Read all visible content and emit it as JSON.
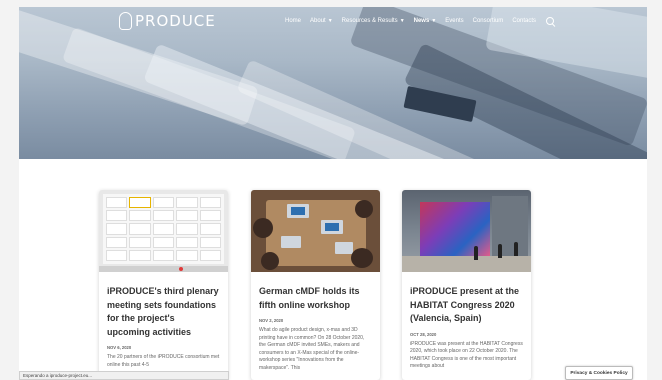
{
  "brand": {
    "logo_text": "PRODUCE"
  },
  "nav": {
    "items": [
      {
        "label": "Home",
        "dropdown": false,
        "active": false
      },
      {
        "label": "About",
        "dropdown": true,
        "active": false
      },
      {
        "label": "Resources & Results",
        "dropdown": true,
        "active": false
      },
      {
        "label": "News",
        "dropdown": true,
        "active": true
      },
      {
        "label": "Events",
        "dropdown": false,
        "active": false
      },
      {
        "label": "Consortium",
        "dropdown": false,
        "active": false
      },
      {
        "label": "Contacts",
        "dropdown": false,
        "active": false
      }
    ],
    "search_icon": "search-icon"
  },
  "cards": [
    {
      "title": "iPRODUCE's third plenary meeting sets foundations for the project's upcoming activities",
      "date": "NOV 6, 2020",
      "excerpt": "The 20 partners of the iPRODUCE consortium met online this past 4-5"
    },
    {
      "title": "German cMDF holds its fifth online workshop",
      "date": "NOV 2, 2020",
      "excerpt": "What do agile product design, x-mas and 3D printing have in common? On 28 October 2020, the German cMDF invited SMEs, makers and consumers to an X-Mas special of the online-workshop series \"Innovations from the makerspace\". This"
    },
    {
      "title": "iPRODUCE present at the HABITAT Congress 2020 (Valencia, Spain)",
      "date": "OCT 28, 2020",
      "excerpt": "iPRODUCE was present at the HABITAT Congress 2020, which took place on 22 October 2020. The HABITAT Congress is one of the most important meetings about"
    }
  ],
  "status_bar": {
    "text": "Esperando a iproduce-project.eu..."
  },
  "privacy_button": {
    "label": "Privacy & Cookies Policy"
  }
}
